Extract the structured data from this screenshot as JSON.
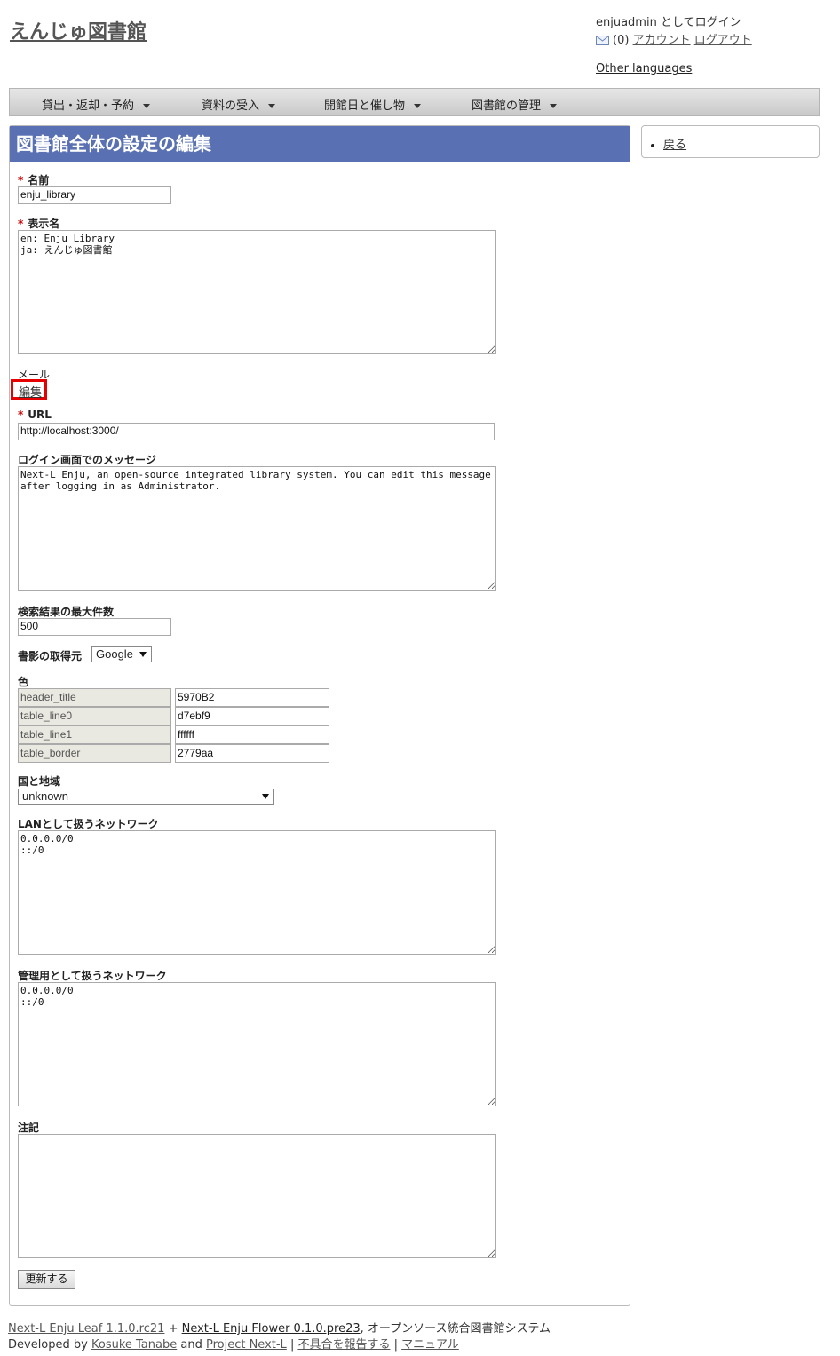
{
  "header": {
    "site_title": "えんじゅ図書館",
    "user_login": "enjuadmin としてログイン",
    "message_count": "(0)",
    "account_link": "アカウント",
    "logout_link": "ログアウト",
    "other_languages": "Other languages"
  },
  "nav": {
    "items": [
      "貸出・返却・予約",
      "資料の受入",
      "開館日と催し物",
      "図書館の管理"
    ]
  },
  "main": {
    "title": "図書館全体の設定の編集",
    "required_mark": "*",
    "fields": {
      "name_label": "名前",
      "name_value": "enju_library",
      "display_name_label": "表示名",
      "display_name_value": "en: Enju Library\nja: えんじゅ図書館",
      "mail_label": "メール",
      "mail_edit_link": "編集",
      "url_label": "URL",
      "url_value": "http://localhost:3000/",
      "login_message_label": "ログイン画面でのメッセージ",
      "login_message_value": "Next-L Enju, an open-source integrated library system. You can edit this message after logging in as Administrator.",
      "max_results_label": "検索結果の最大件数",
      "max_results_value": "500",
      "book_jacket_label": "書影の取得元",
      "book_jacket_value": "Google",
      "color_label": "色",
      "colors": [
        {
          "key": "header_title",
          "value": "5970B2"
        },
        {
          "key": "table_line0",
          "value": "d7ebf9"
        },
        {
          "key": "table_line1",
          "value": "ffffff"
        },
        {
          "key": "table_border",
          "value": "2779aa"
        }
      ],
      "country_label": "国と地域",
      "country_value": "unknown",
      "lan_label": "LANとして扱うネットワーク",
      "lan_value": "0.0.0.0/0\n::/0",
      "admin_net_label": "管理用として扱うネットワーク",
      "admin_net_value": "0.0.0.0/0\n::/0",
      "note_label": "注記",
      "note_value": ""
    },
    "submit_label": "更新する"
  },
  "sidebar": {
    "back_link": "戻る"
  },
  "footer": {
    "leaf_link": "Next-L Enju Leaf 1.1.0.rc21",
    "plus": " + ",
    "flower_link": "Next-L Enju Flower 0.1.0.pre23",
    "system_text": ", オープンソース統合図書館システム",
    "developed_by": "Developed by ",
    "author_link": "Kosuke Tanabe",
    "and_text": " and ",
    "project_link": "Project Next-L",
    "sep": " | ",
    "report_link": "不具合を報告する",
    "manual_link": "マニュアル"
  },
  "colors": {
    "header_bar": "#5970B2",
    "highlight_box": "#e60000"
  }
}
